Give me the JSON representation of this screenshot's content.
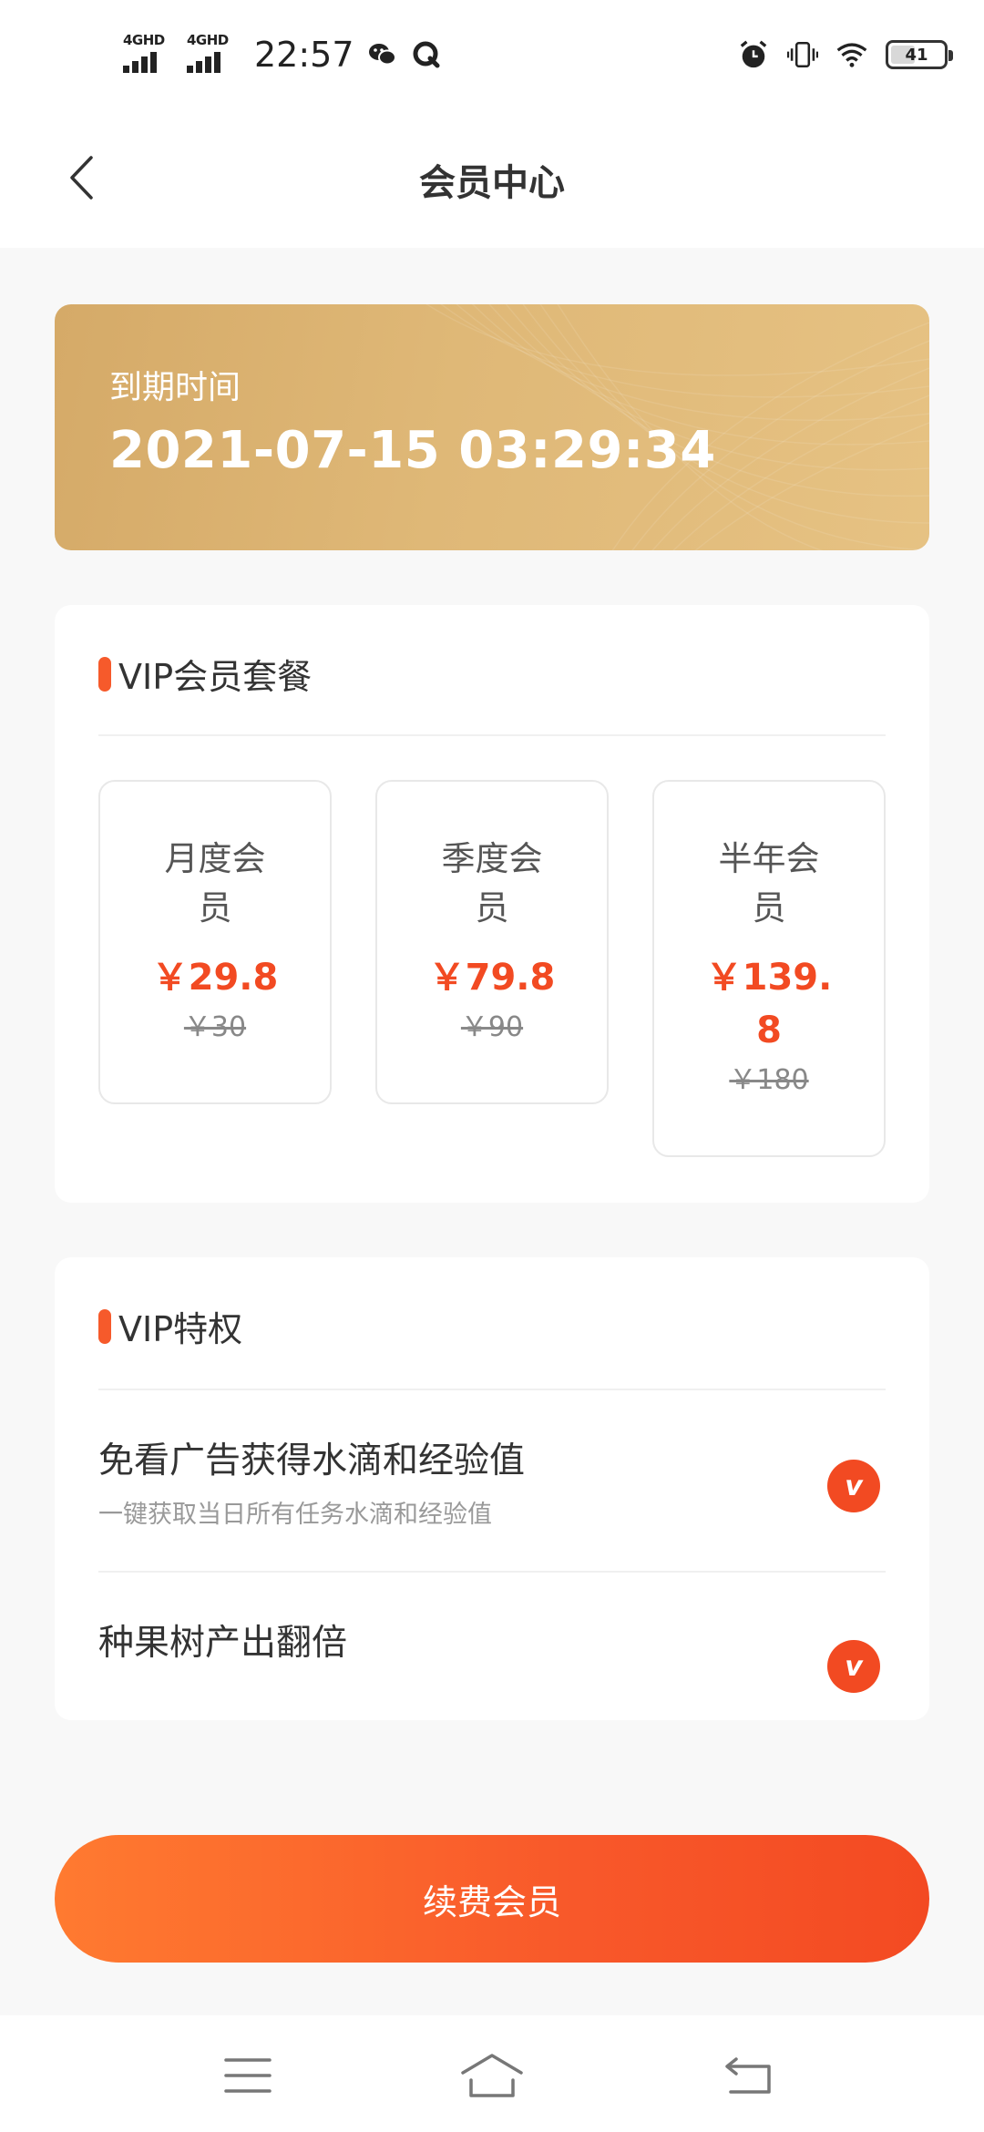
{
  "status_bar": {
    "network_1": "4GHD",
    "network_2": "4GHD",
    "time": "22:57",
    "battery": "41"
  },
  "header": {
    "title": "会员中心"
  },
  "expiry": {
    "label": "到期时间",
    "datetime": "2021-07-15 03:29:34"
  },
  "plans_section": {
    "title": "VIP会员套餐",
    "plans": [
      {
        "name_line1": "月度会",
        "name_line2": "员",
        "price_line1": "￥29.8",
        "price_line2": "",
        "original": "￥30"
      },
      {
        "name_line1": "季度会",
        "name_line2": "员",
        "price_line1": "￥79.8",
        "price_line2": "",
        "original": "￥90"
      },
      {
        "name_line1": "半年会",
        "name_line2": "员",
        "price_line1": "￥139.",
        "price_line2": "8",
        "original": "￥180"
      }
    ]
  },
  "perks_section": {
    "title": "VIP特权",
    "perks": [
      {
        "title": "免看广告获得水滴和经验值",
        "desc": "一键获取当日所有任务水滴和经验值",
        "check": "v"
      },
      {
        "title": "种果树产出翻倍",
        "desc": "",
        "check": "v"
      }
    ]
  },
  "actions": {
    "renew_label": "续费会员"
  },
  "colors": {
    "accent": "#f24a22",
    "gold": "#dfb877"
  },
  "icons": {
    "back": "chevron-left-icon",
    "check": "check-badge-icon",
    "menu": "menu-icon",
    "home": "home-icon",
    "return": "return-icon"
  }
}
